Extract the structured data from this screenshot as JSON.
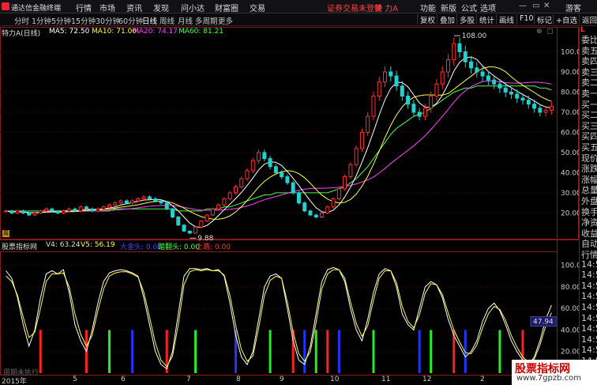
{
  "menubar": {
    "app_title": "通达信金融终端",
    "items": [
      "行情",
      "市场",
      "资讯",
      "发现",
      "问小达",
      "财富圈",
      "交易"
    ],
    "alert": "证券交易未登录",
    "stock_name": "特 力A",
    "right_items": [
      "功能",
      "新版",
      "公式",
      "选项"
    ],
    "guest": "游客"
  },
  "toolbar": {
    "timeframes": [
      "分时",
      "1分钟",
      "5分钟",
      "15分钟",
      "30分钟",
      "60分钟",
      "日线",
      "周线",
      "月线",
      "多周期",
      "更多"
    ],
    "active_timeframe": "日线",
    "right_buttons": [
      "复权",
      "叠加",
      "多股",
      "统计",
      "画线",
      "F10",
      "标记",
      "+自选",
      "返回"
    ]
  },
  "price_header": {
    "title": "特力A(日线)",
    "ma5": "MA5: 72.50",
    "ma10": "MA10: 71.00",
    "ma20": "MA20: 74.17",
    "ma60": "MA60: 81.21",
    "ma5_color": "#ffffff",
    "ma10_color": "#ffff44",
    "ma20_color": "#ff44ff",
    "ma60_color": "#44ff44"
  },
  "indicator_header": {
    "name": "股票指标网",
    "v4": "V4: 63.24",
    "v5": "V5: 56.19",
    "big_lead": "大金头: 0.00",
    "pig_head": "踏翻头: 0.00",
    "up_road": "上路: 0.00",
    "v5_color": "#ffff44",
    "big_lead_color": "#4444ff",
    "pig_head_color": "#44ff44",
    "up_road_color": "#ff3333"
  },
  "price_axis": {
    "ticks": [
      "100.0",
      "90.00",
      "80.00",
      "70.00",
      "60.00",
      "50.00",
      "40.00",
      "30.00",
      "20.00"
    ],
    "high_label": "108.00",
    "low_label": "9.88"
  },
  "indicator_axis": {
    "ticks": [
      "100.0",
      "80.00",
      "60.00",
      "40.00",
      "20.00"
    ],
    "current_value": "47.94"
  },
  "side_panel": {
    "top_label": "L",
    "items": [
      "委比",
      "卖五",
      "卖四",
      "卖三",
      "卖二",
      "卖一",
      "买一",
      "买二",
      "买三",
      "买四",
      "买五",
      "现价",
      "涨跌",
      "涨幅",
      "总量",
      "外盘",
      "换手",
      "净资",
      "收益",
      "自动",
      "行情",
      "14:5",
      "14:5",
      "14:5",
      "14:5",
      "14:5",
      "14:5",
      "14:5",
      "14:5",
      "14:5",
      "14:5"
    ]
  },
  "date_axis": {
    "labels": [
      "2015年",
      "5",
      "6",
      "7",
      "8",
      "9",
      "10",
      "11",
      "12",
      "2",
      "3"
    ]
  },
  "watermark": {
    "title": "股票指标网",
    "url": "www.7gpzb.com"
  },
  "overlay_text": "周期未执行",
  "chart_data": {
    "type": "candlestick",
    "title": "特力A(日线)",
    "ylim": [
      8,
      110
    ],
    "high": 108.0,
    "low": 9.88,
    "close_series": [
      21,
      20,
      21,
      20,
      19,
      20,
      21,
      22,
      21,
      20,
      21,
      22,
      21,
      23,
      22,
      21,
      22,
      23,
      24,
      25,
      26,
      25,
      26,
      27,
      28,
      27,
      26,
      25,
      22,
      18,
      14,
      11,
      10,
      13,
      16,
      19,
      22,
      24,
      27,
      30,
      33,
      37,
      41,
      46,
      50,
      47,
      43,
      40,
      38,
      35,
      30,
      25,
      21,
      19,
      18,
      20,
      23,
      27,
      32,
      38,
      44,
      52,
      60,
      68,
      78,
      85,
      90,
      88,
      83,
      78,
      74,
      70,
      68,
      72,
      78,
      84,
      90,
      96,
      104,
      100,
      95,
      92,
      90,
      88,
      86,
      84,
      82,
      80,
      79,
      77,
      76,
      74,
      72,
      70,
      71,
      73
    ],
    "ma60_series": [
      21,
      21,
      21,
      21,
      21,
      21,
      21,
      21,
      21,
      21,
      21,
      21,
      21,
      21,
      21,
      21,
      21,
      21,
      21,
      22,
      22,
      22,
      22,
      22,
      22,
      22,
      22,
      22,
      22,
      22,
      21,
      21,
      21,
      21,
      21,
      22,
      22,
      22,
      23,
      23,
      24,
      25,
      26,
      27,
      28,
      29,
      29,
      30,
      30,
      30,
      30,
      30,
      30,
      30,
      30,
      30,
      30,
      31,
      32,
      33,
      35,
      37,
      40,
      43,
      47,
      51,
      55,
      59,
      62,
      64,
      66,
      68,
      69,
      70,
      72,
      74,
      76,
      78,
      80,
      81,
      82,
      82,
      83,
      83,
      83,
      83,
      83,
      83,
      83,
      83,
      83,
      83,
      83,
      82,
      82,
      81
    ],
    "indicator": {
      "ylim": [
        0,
        110
      ],
      "v4_series": [
        95,
        88,
        70,
        45,
        25,
        40,
        70,
        92,
        95,
        92,
        96,
        75,
        45,
        30,
        20,
        40,
        65,
        85,
        93,
        95,
        96,
        95,
        93,
        90,
        70,
        45,
        20,
        8,
        4,
        20,
        55,
        90,
        97,
        97,
        96,
        97,
        95,
        96,
        90,
        65,
        35,
        15,
        8,
        20,
        50,
        80,
        90,
        92,
        88,
        60,
        30,
        12,
        8,
        25,
        55,
        85,
        96,
        98,
        96,
        85,
        60,
        40,
        30,
        50,
        75,
        92,
        97,
        95,
        80,
        55,
        45,
        40,
        60,
        80,
        85,
        82,
        70,
        50,
        35,
        25,
        15,
        20,
        30,
        48,
        60,
        65,
        58,
        45,
        30,
        20,
        12,
        8,
        15,
        30,
        50,
        63
      ],
      "v5_series": [
        90,
        85,
        72,
        52,
        33,
        38,
        60,
        85,
        92,
        92,
        93,
        80,
        55,
        36,
        25,
        35,
        58,
        78,
        90,
        93,
        94,
        94,
        92,
        89,
        75,
        52,
        28,
        12,
        6,
        16,
        45,
        82,
        94,
        96,
        95,
        96,
        95,
        95,
        91,
        72,
        44,
        22,
        11,
        16,
        42,
        72,
        86,
        90,
        88,
        66,
        38,
        18,
        11,
        20,
        47,
        78,
        92,
        96,
        96,
        88,
        66,
        46,
        34,
        44,
        68,
        88,
        95,
        95,
        84,
        62,
        48,
        42,
        54,
        74,
        83,
        82,
        73,
        56,
        40,
        29,
        19,
        18,
        26,
        42,
        55,
        62,
        59,
        49,
        35,
        24,
        15,
        10,
        13,
        26,
        44,
        56
      ],
      "markers": [
        {
          "i": 6,
          "color": "red"
        },
        {
          "i": 14,
          "color": "red"
        },
        {
          "i": 18,
          "color": "green"
        },
        {
          "i": 22,
          "color": "blue"
        },
        {
          "i": 28,
          "color": "red"
        },
        {
          "i": 33,
          "color": "green"
        },
        {
          "i": 40,
          "color": "blue"
        },
        {
          "i": 46,
          "color": "green"
        },
        {
          "i": 50,
          "color": "red"
        },
        {
          "i": 52,
          "color": "blue"
        },
        {
          "i": 54,
          "color": "green"
        },
        {
          "i": 56,
          "color": "red"
        },
        {
          "i": 58,
          "color": "blue"
        },
        {
          "i": 64,
          "color": "green"
        },
        {
          "i": 72,
          "color": "blue"
        },
        {
          "i": 74,
          "color": "green"
        },
        {
          "i": 78,
          "color": "red"
        },
        {
          "i": 80,
          "color": "blue"
        },
        {
          "i": 86,
          "color": "green"
        },
        {
          "i": 90,
          "color": "red"
        }
      ]
    }
  }
}
